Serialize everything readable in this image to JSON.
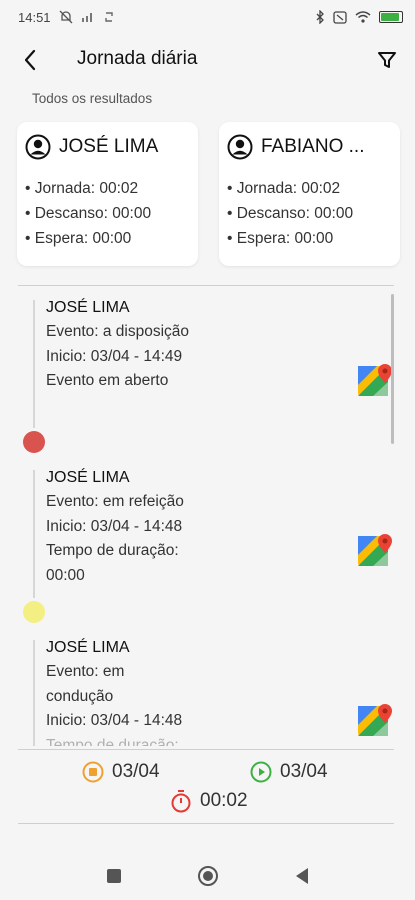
{
  "status_bar": {
    "time": "14:51",
    "battery_level": "90",
    "icons": [
      "muted-icon",
      "data-icon",
      "sync-icon",
      "bluetooth-icon",
      "nfc-icon",
      "wifi-icon",
      "battery-icon"
    ]
  },
  "header": {
    "title": "Jornada diária",
    "back_icon": "chevron-left-icon",
    "filter_icon": "filter-icon"
  },
  "results_label": "Todos os resultados",
  "summary_cards": [
    {
      "name": "JOSÉ LIMA",
      "jornada": "• Jornada: 00:02",
      "descanso": "• Descanso:  00:00",
      "espera": "• Espera:  00:00"
    },
    {
      "name": "FABIANO ...",
      "jornada": "• Jornada: 00:02",
      "descanso": "• Descanso:  00:00",
      "espera": "• Espera:  00:00"
    }
  ],
  "events": [
    {
      "name": "JOSÉ LIMA",
      "lines": [
        "Evento: a disposição",
        "Inicio: 03/04 - 14:49",
        "Evento em aberto"
      ],
      "dot_color": "#d9534f"
    },
    {
      "name": "JOSÉ LIMA",
      "lines": [
        "Evento: em refeição",
        "Inicio: 03/04 - 14:48",
        "Tempo de duração:",
        "00:00"
      ],
      "dot_color": "#f3ef82"
    },
    {
      "name": "JOSÉ LIMA",
      "lines": [
        "Evento: em",
        "condução",
        "Inicio: 03/04 - 14:48",
        "Tempo de duração:"
      ],
      "dot_color": "#d6d6d6"
    }
  ],
  "bottom_summary": {
    "start_date": "03/04",
    "end_date": "03/04",
    "total_time": "00:02",
    "colors": {
      "start": "#f0a030",
      "end": "#3cb043",
      "total": "#e53935"
    }
  },
  "nav_bar": {
    "icons": [
      "recents-icon",
      "home-icon",
      "back-icon"
    ]
  }
}
